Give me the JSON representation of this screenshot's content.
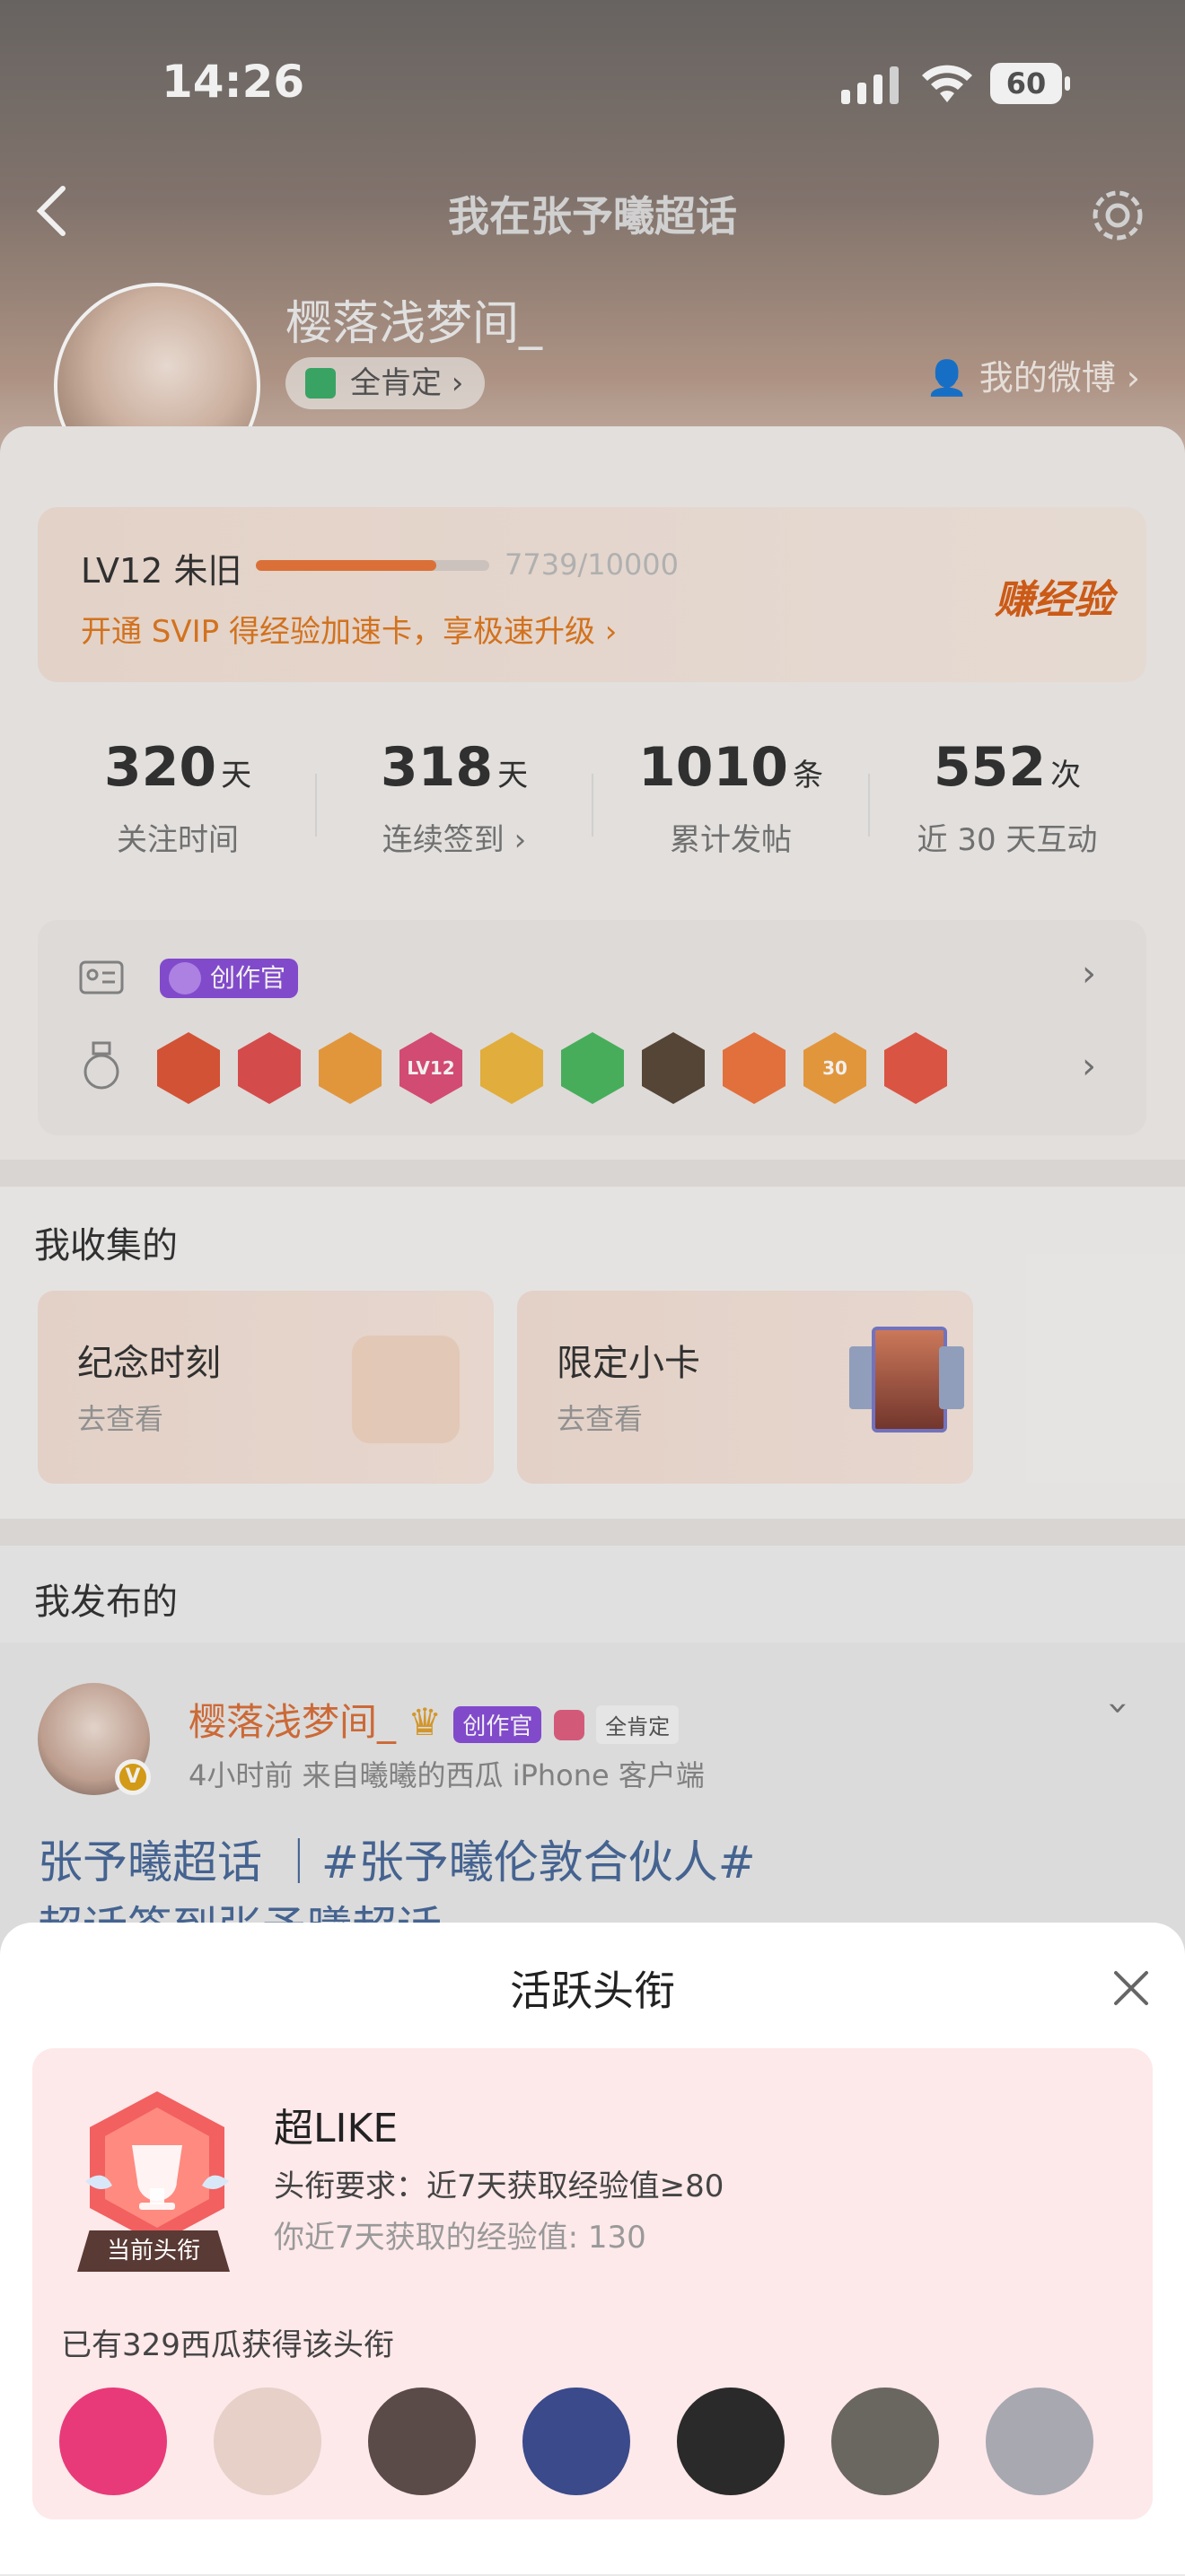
{
  "status_bar": {
    "time": "14:26",
    "battery": "60"
  },
  "header": {
    "title": "我在张予曦超话",
    "back_icon": "chevron-left-icon",
    "settings_icon": "gear-icon"
  },
  "profile": {
    "username": "樱落浅梦间_",
    "tag": "全肯定 ›",
    "my_weibo": "我的微博 ›",
    "verified_mark": "V"
  },
  "level": {
    "label": "LV12 朱旧",
    "progress": "7739/10000",
    "progress_fraction": 0.7739,
    "promo": "开通 SVIP 得经验加速卡，享极速升级 ›",
    "earn_button": "赚经验"
  },
  "stats": [
    {
      "value": "320",
      "unit": "天",
      "label": "关注时间"
    },
    {
      "value": "318",
      "unit": "天",
      "label": "连续签到 ›"
    },
    {
      "value": "1010",
      "unit": "条",
      "label": "累计发帖"
    },
    {
      "value": "552",
      "unit": "次",
      "label": "近 30 天互动"
    }
  ],
  "badges": {
    "creator_tag": "创作官",
    "badge_colors": [
      "#e0583a",
      "#e25050",
      "#f0a040",
      "#e0507a",
      "#f0b840",
      "#4cb860",
      "#5a4a3a",
      "#f07840",
      "#f0a040",
      "#e85a48"
    ],
    "badge_labels": [
      "",
      "",
      "",
      "LV12",
      "",
      "",
      "",
      "",
      "30",
      ""
    ]
  },
  "collection": {
    "title": "我收集的",
    "cards": [
      {
        "title": "纪念时刻",
        "sub": "去查看"
      },
      {
        "title": "限定小卡",
        "sub": "去查看"
      }
    ]
  },
  "posts": {
    "title": "我发布的",
    "item": {
      "name": "樱落浅梦间_",
      "creator_tag": "创作官",
      "tag": "全肯定",
      "meta": "4小时前  来自曦曦的西瓜 iPhone 客户端",
      "line1": "张予曦超话  ｜#张予曦伦敦合伙人#",
      "line2": "超话签到张予曦超话"
    }
  },
  "sheet": {
    "title": "活跃头衔",
    "title_name": "超LIKE",
    "requirement": "头衔要求：近7天获取经验值≥80",
    "my_exp": "你近7天获取的经验值: 130",
    "current_badge": "当前头衔",
    "holders": "已有329西瓜获得该头衔",
    "avatar_colors": [
      "#e83a78",
      "#e6d0c8",
      "#5a4a48",
      "#3a4a8a",
      "#2a2a2a",
      "#6a6660",
      "#a8a8b0"
    ]
  }
}
